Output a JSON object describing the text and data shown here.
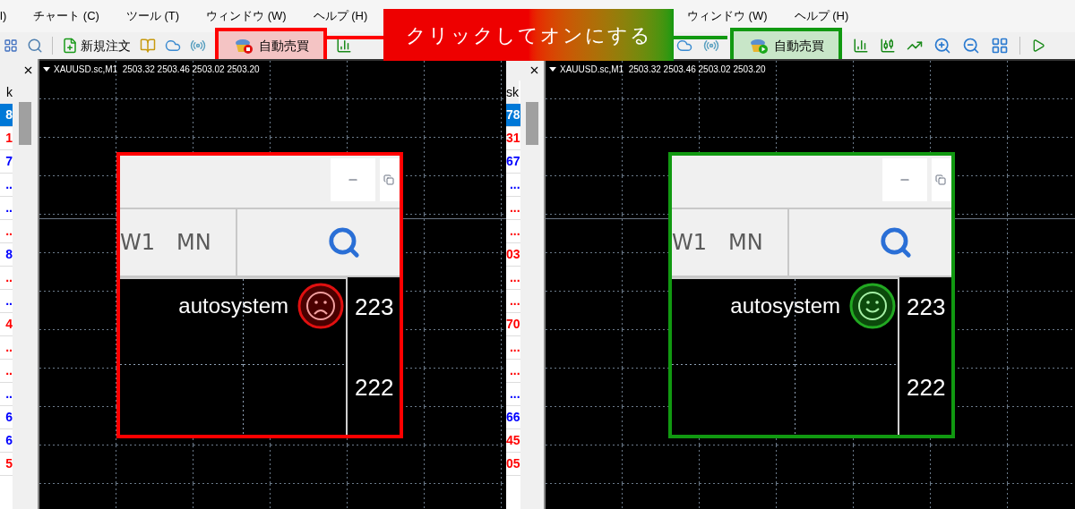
{
  "callout": {
    "text": "クリックしてオンにする"
  },
  "panels": [
    {
      "auto_trading": false,
      "menu": [
        "l)",
        "チャート (C)",
        "ツール (T)",
        "ウィンドウ (W)",
        "ヘルプ (H)"
      ],
      "new_order": "新規注文",
      "auto_label": "自動売買",
      "chart_title": "XAUUSD.sc,M1  2503.32 2503.46 2503.02 2503.20",
      "watch_header": "k",
      "watch_rows": [
        {
          "value": "8",
          "selected": true
        },
        {
          "value": "1",
          "selected": false,
          "color": "#ff0000"
        },
        {
          "value": "7",
          "selected": false,
          "color": "#0000ff"
        },
        {
          "value": "..",
          "selected": false,
          "color": "#0000ff"
        },
        {
          "value": "..",
          "selected": false,
          "color": "#0000ff"
        },
        {
          "value": "..",
          "selected": false,
          "color": "#ff0000"
        },
        {
          "value": "8",
          "selected": false,
          "color": "#0000ff"
        },
        {
          "value": "..",
          "selected": false,
          "color": "#ff0000"
        },
        {
          "value": "..",
          "selected": false,
          "color": "#0000ff"
        },
        {
          "value": "4",
          "selected": false,
          "color": "#ff0000"
        },
        {
          "value": "..",
          "selected": false,
          "color": "#ff0000"
        },
        {
          "value": "..",
          "selected": false,
          "color": "#ff0000"
        },
        {
          "value": "..",
          "selected": false,
          "color": "#0000ff"
        },
        {
          "value": "6",
          "selected": false,
          "color": "#0000ff"
        },
        {
          "value": "6",
          "selected": false,
          "color": "#0000ff"
        },
        {
          "value": "5",
          "selected": false,
          "color": "#ff0000"
        }
      ],
      "inset": {
        "timeframes": [
          "W1",
          "MN"
        ],
        "label": "autosystem",
        "prices": [
          "223",
          "222"
        ]
      }
    },
    {
      "auto_trading": true,
      "menu": [
        "ウィンドウ (W)",
        "ヘルプ (H)"
      ],
      "auto_label": "自動売買",
      "chart_title": "XAUUSD.sc,M1  2503.32 2503.46 2503.02 2503.20",
      "watch_header": "sk",
      "watch_rows": [
        {
          "value": "78",
          "selected": true
        },
        {
          "value": "31",
          "selected": false,
          "color": "#ff0000"
        },
        {
          "value": "67",
          "selected": false,
          "color": "#0000ff"
        },
        {
          "value": "...",
          "selected": false,
          "color": "#0000ff"
        },
        {
          "value": "...",
          "selected": false,
          "color": "#ff0000"
        },
        {
          "value": "...",
          "selected": false,
          "color": "#ff0000"
        },
        {
          "value": "03",
          "selected": false,
          "color": "#ff0000"
        },
        {
          "value": "...",
          "selected": false,
          "color": "#ff0000"
        },
        {
          "value": "...",
          "selected": false,
          "color": "#ff0000"
        },
        {
          "value": "70",
          "selected": false,
          "color": "#ff0000"
        },
        {
          "value": "...",
          "selected": false,
          "color": "#ff0000"
        },
        {
          "value": "...",
          "selected": false,
          "color": "#ff0000"
        },
        {
          "value": "...",
          "selected": false,
          "color": "#0000ff"
        },
        {
          "value": "66",
          "selected": false,
          "color": "#0000ff"
        },
        {
          "value": "45",
          "selected": false,
          "color": "#ff0000"
        },
        {
          "value": "05",
          "selected": false,
          "color": "#ff0000"
        }
      ],
      "inset": {
        "timeframes": [
          "W1",
          "MN"
        ],
        "label": "autosystem",
        "prices": [
          "223",
          "222"
        ]
      }
    }
  ]
}
